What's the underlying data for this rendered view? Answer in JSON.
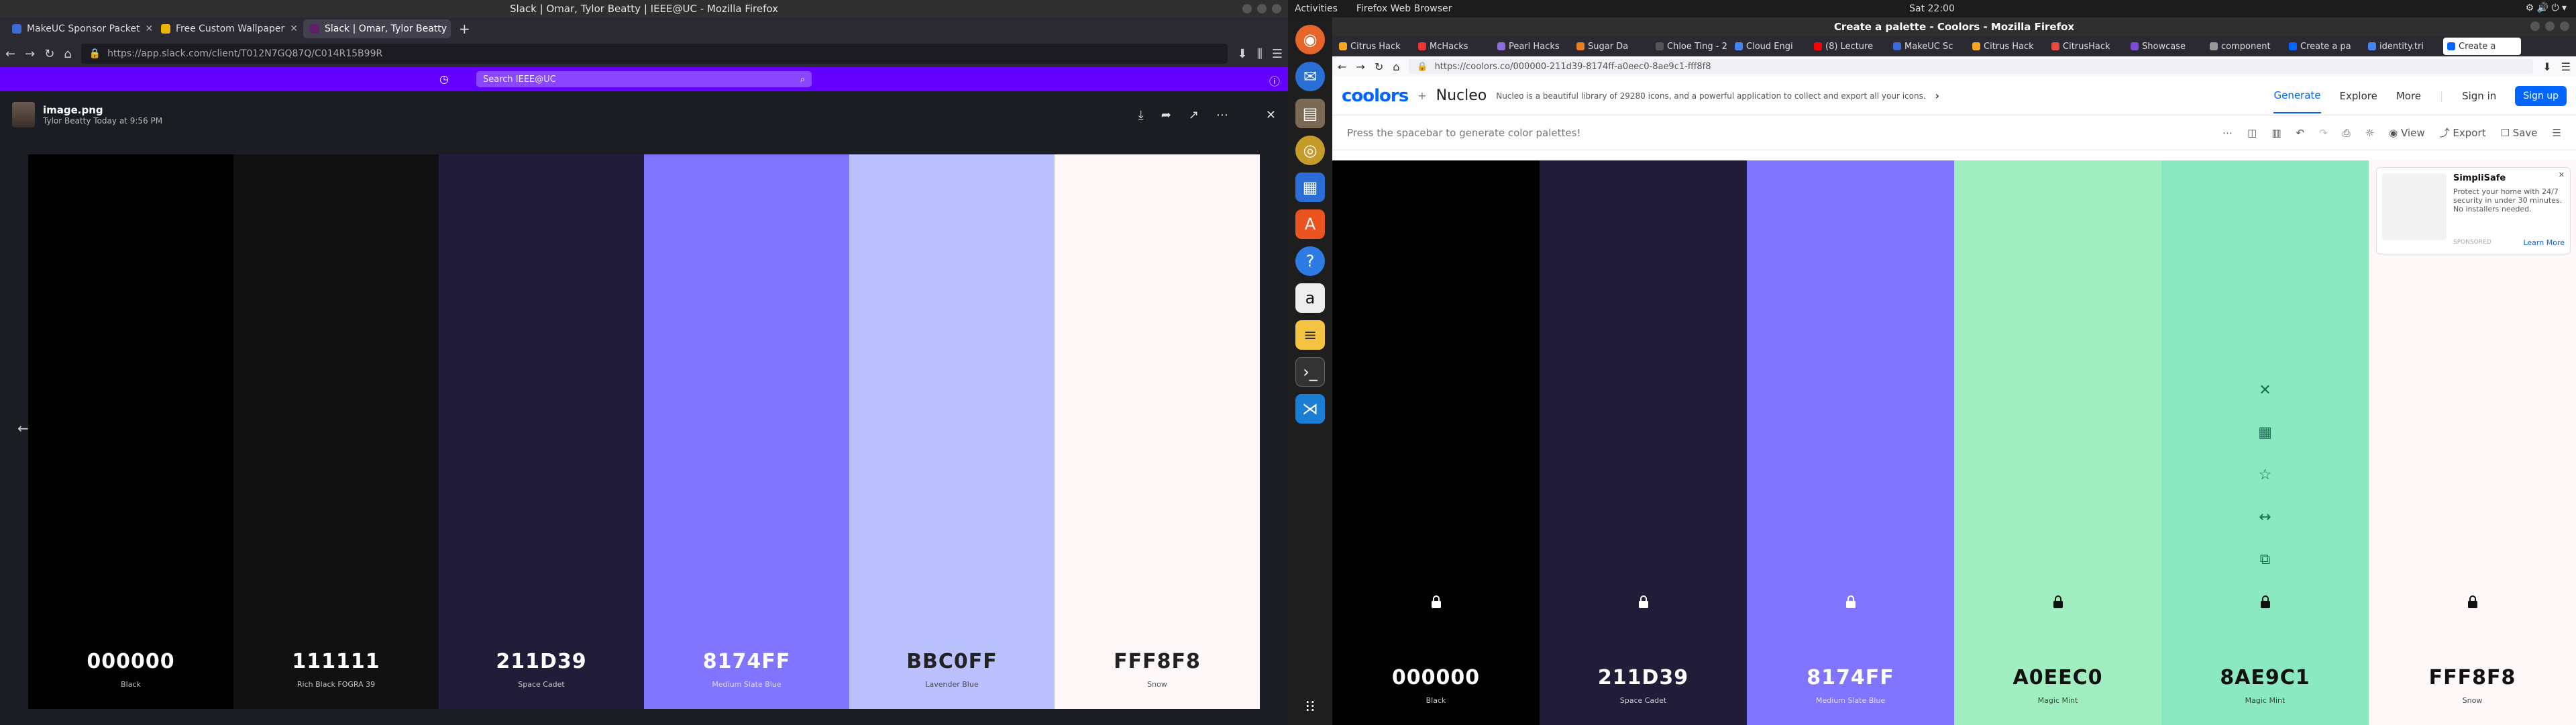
{
  "left_window": {
    "title": "Slack | Omar, Tylor Beatty | IEEE@UC - Mozilla Firefox",
    "tabs": [
      {
        "label": "MakeUC Sponsor Packet",
        "color": "#3b6bd6"
      },
      {
        "label": "Free Custom Wallpaper",
        "color": "#f0b400"
      },
      {
        "label": "Slack | Omar, Tylor Beatty",
        "color": "#611f69",
        "active": true
      }
    ],
    "url": "https://app.slack.com/client/T012N7GQ87Q/C014R15B99R",
    "slack_search_placeholder": "Search IEEE@UC",
    "file": {
      "name": "image.png",
      "author": "Tylor Beatty",
      "time": "Today at 9:56 PM"
    },
    "palette": [
      {
        "hex": "000000",
        "name": "Black",
        "bg": "#000000",
        "fg": "#ffffff"
      },
      {
        "hex": "111111",
        "name": "Rich Black FOGRA 39",
        "bg": "#111111",
        "fg": "#ffffff"
      },
      {
        "hex": "211D39",
        "name": "Space Cadet",
        "bg": "#211d39",
        "fg": "#ffffff"
      },
      {
        "hex": "8174FF",
        "name": "Medium Slate Blue",
        "bg": "#8174ff",
        "fg": "#ffffff"
      },
      {
        "hex": "BBC0FF",
        "name": "Lavender Blue",
        "bg": "#bbc0ff",
        "fg": "#222222"
      },
      {
        "hex": "FFF8F8",
        "name": "Snow",
        "bg": "#fff8f8",
        "fg": "#222222"
      }
    ]
  },
  "top_bar": {
    "activities": "Activities",
    "app": "Firefox Web Browser",
    "clock": "Sat 22:00"
  },
  "right_window": {
    "title": "Create a palette - Coolors - Mozilla Firefox",
    "tabs": [
      {
        "label": "Citrus Hack",
        "color": "#f5a623"
      },
      {
        "label": "McHacks",
        "color": "#e33"
      },
      {
        "label": "Pearl Hacks",
        "color": "#8a6dd8"
      },
      {
        "label": "Sugar Da",
        "color": "#e67e22"
      },
      {
        "label": "Chloe Ting - 2",
        "color": "#555"
      },
      {
        "label": "Cloud Engi",
        "color": "#4285f4"
      },
      {
        "label": "(8) Lecture",
        "color": "#ff0000"
      },
      {
        "label": "MakeUC Sc",
        "color": "#3b6bd6"
      },
      {
        "label": "Citrus Hack",
        "color": "#f5a623"
      },
      {
        "label": "CitrusHack",
        "color": "#e74c3c"
      },
      {
        "label": "Showcase",
        "color": "#7d4cdb"
      },
      {
        "label": "component",
        "color": "#999"
      },
      {
        "label": "Create a pa",
        "color": "#0066ff"
      },
      {
        "label": "identity.tri",
        "color": "#4285f4"
      },
      {
        "label": "Create a",
        "color": "#0066ff",
        "active": true
      }
    ],
    "url": "https://coolors.co/000000-211d39-8174ff-a0eec0-8ae9c1-fff8f8",
    "logo": "coolors",
    "nucleo": "Nucleo",
    "ad_text": "Nucleo is a beautiful library of 29280 icons, and a powerful application to collect and export all your icons.",
    "nav": {
      "generate": "Generate",
      "explore": "Explore",
      "more": "More",
      "signin": "Sign in",
      "signup": "Sign up"
    },
    "hint": "Press the spacebar to generate color palettes!",
    "toolbar": {
      "view": "View",
      "export": "Export",
      "save": "Save"
    },
    "adbox": {
      "title": "SimpliSafe",
      "body": "Protect your home with 24/7 security in under 30 minutes. No installers needed.",
      "sponsor": "SPONSORED",
      "cta": "Learn More"
    },
    "palette": [
      {
        "hex": "000000",
        "name": "Black",
        "bg": "#000000",
        "fg": "#ffffff"
      },
      {
        "hex": "211D39",
        "name": "Space Cadet",
        "bg": "#211d39",
        "fg": "#ffffff"
      },
      {
        "hex": "8174FF",
        "name": "Medium Slate Blue",
        "bg": "#8174ff",
        "fg": "#ffffff"
      },
      {
        "hex": "A0EEC0",
        "name": "Magic Mint",
        "bg": "#a0eec0",
        "fg": "#111111"
      },
      {
        "hex": "8AE9C1",
        "name": "Magic Mint",
        "bg": "#8ae9c1",
        "fg": "#111111"
      },
      {
        "hex": "FFF8F8",
        "name": "Snow",
        "bg": "#fff8f8",
        "fg": "#111111"
      }
    ]
  }
}
